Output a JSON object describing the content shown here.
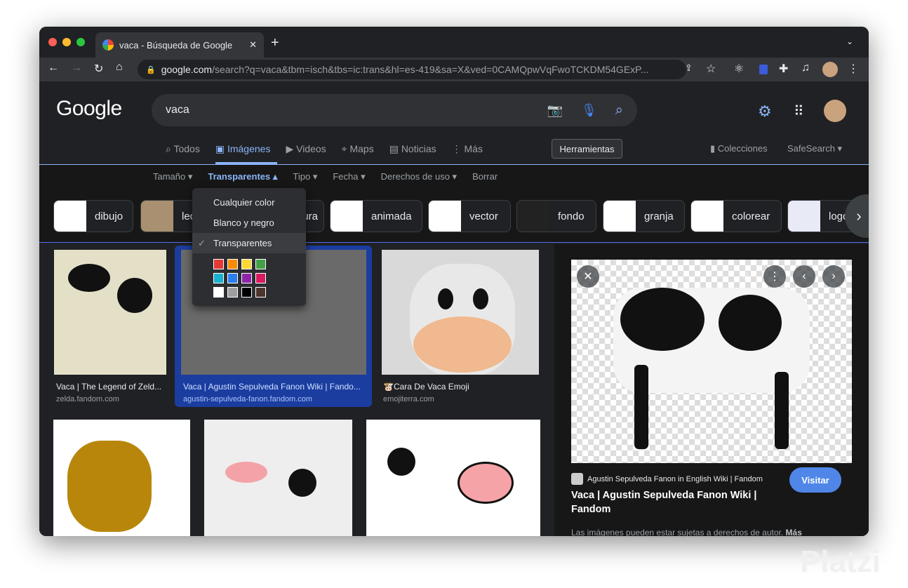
{
  "browser": {
    "tab_title": "vaca - Búsqueda de Google",
    "url_host": "google.com",
    "url_path": "/search?q=vaca&tbm=isch&tbs=ic:trans&hl=es-419&sa=X&ved=0CAMQpwVqFwoTCKDM54GExP..."
  },
  "google": {
    "logo": "Google",
    "query": "vaca"
  },
  "nav": {
    "tabs": [
      "Todos",
      "Imágenes",
      "Videos",
      "Maps",
      "Noticias",
      "Más"
    ],
    "tools": "Herramientas",
    "collections": "Colecciones",
    "safesearch": "SafeSearch"
  },
  "filters": {
    "items": [
      "Tamaño",
      "Transparentes",
      "Tipo",
      "Fecha",
      "Derechos de uso",
      "Borrar"
    ]
  },
  "chips": [
    "dibujo",
    "leche",
    "caricatura",
    "animada",
    "vector",
    "fondo",
    "granja",
    "colorear",
    "logo"
  ],
  "dropdown": {
    "items": [
      "Cualquier color",
      "Blanco y negro",
      "Transparentes"
    ],
    "selected": "Transparentes",
    "swatches": [
      "#e53935",
      "#fb8c00",
      "#fdd835",
      "#43a047",
      "#1ab0d0",
      "#2a7ef0",
      "#8e24aa",
      "#d81b60",
      "#ffffff",
      "#9e9e9e",
      "#000000",
      "#4e342e"
    ]
  },
  "results": [
    {
      "title": "Vaca | The Legend of Zeld...",
      "source": "zelda.fandom.com"
    },
    {
      "title": "Vaca | Agustin Sepulveda Fanon Wiki | Fando...",
      "source": "agustin-sepulveda-fanon.fandom.com"
    },
    {
      "title": "🐮Cara De Vaca Emoji",
      "source": "emojiterra.com"
    }
  ],
  "panel": {
    "site": "Agustin Sepulveda Fanon in English Wiki | Fandom",
    "title": "Vaca | Agustin Sepulveda Fanon Wiki | Fandom",
    "visit": "Visitar",
    "notice": "Las imágenes pueden estar sujetas a derechos de autor.",
    "more": "Más"
  },
  "watermark": "Platzi"
}
